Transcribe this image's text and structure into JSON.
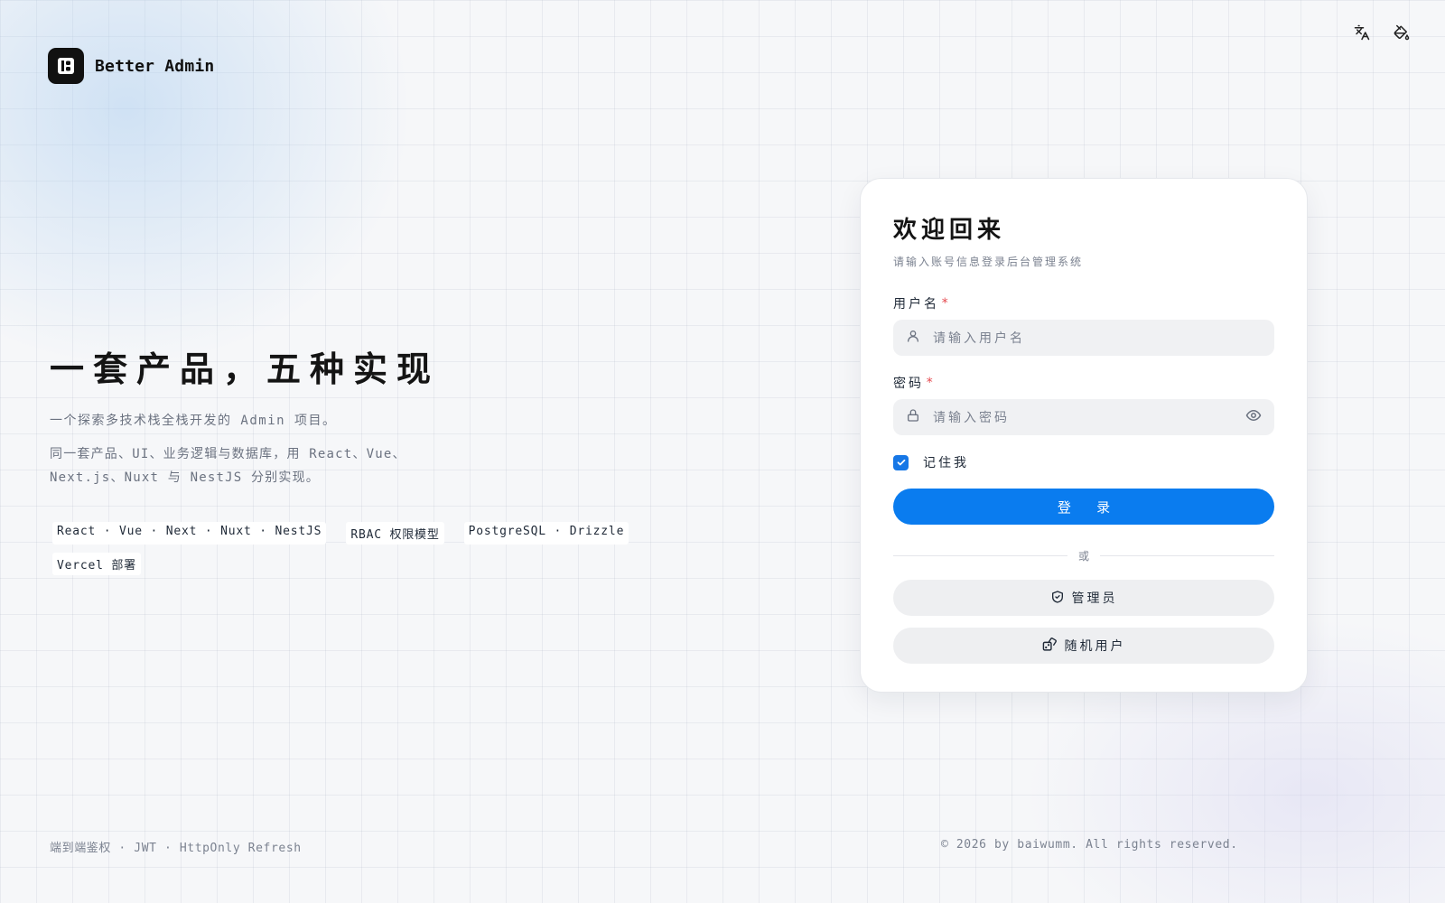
{
  "brand": {
    "name": "Better Admin",
    "logo_icon": "logo-icon"
  },
  "toolbar": {
    "translate_icon": "translate-icon",
    "theme_icon": "paint-bucket-icon"
  },
  "hero": {
    "title": "一套产品，五种实现",
    "subtitle": "一个探索多技术栈全栈开发的 Admin 项目。",
    "description": "同一套产品、UI、业务逻辑与数据库，用 React、Vue、Next.js、Nuxt 与 NestJS 分别实现。",
    "tags": [
      "React · Vue · Next · Nuxt · NestJS",
      "RBAC 权限模型",
      "PostgreSQL · Drizzle",
      "Vercel 部署"
    ]
  },
  "login": {
    "title": "欢迎回来",
    "subtitle": "请输入账号信息登录后台管理系统",
    "username": {
      "label": "用户名",
      "required_mark": "*",
      "placeholder": "请输入用户名",
      "value": ""
    },
    "password": {
      "label": "密码",
      "required_mark": "*",
      "placeholder": "请输入密码",
      "value": ""
    },
    "remember": {
      "label": "记住我",
      "checked": true
    },
    "submit_label": "登 录",
    "divider_text": "或",
    "admin_label": "管理员",
    "random_user_label": "随机用户",
    "accent_color": "#0a7cef"
  },
  "footer": {
    "left": "端到端鉴权 · JWT · HttpOnly Refresh",
    "right": "© 2026 by baiwumm. All rights reserved."
  }
}
